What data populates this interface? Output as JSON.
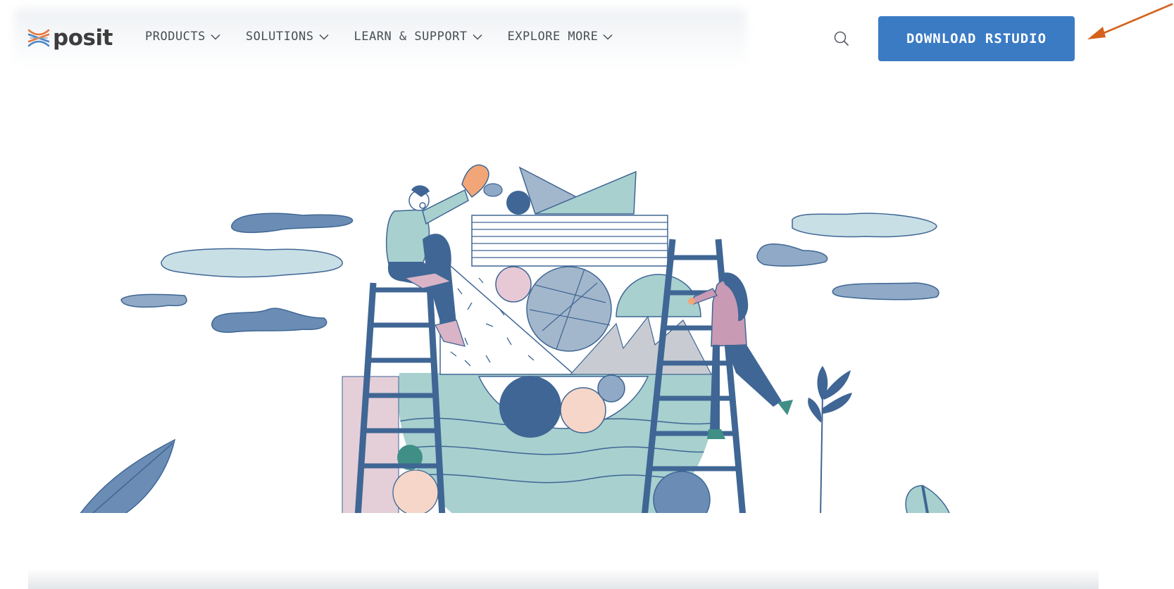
{
  "brand": {
    "name": "posit",
    "logo_icon": "posit-logo-icon"
  },
  "nav": {
    "items": [
      {
        "label": "PRODUCTS",
        "icon": "chevron-down-icon"
      },
      {
        "label": "SOLUTIONS",
        "icon": "chevron-down-icon"
      },
      {
        "label": "LEARN & SUPPORT",
        "icon": "chevron-down-icon"
      },
      {
        "label": "EXPLORE MORE",
        "icon": "chevron-down-icon"
      }
    ],
    "search_icon": "search-icon"
  },
  "cta": {
    "download_label": "DOWNLOAD RSTUDIO"
  },
  "hero": {
    "illustration": "people-building-shapes-illustration"
  },
  "colors": {
    "button": "#3b7bc4",
    "nav_text": "#4a4f55",
    "logo_orange": "#e8773b",
    "logo_blue": "#4a86c7",
    "annotation_arrow": "#d4621b",
    "illus_navy": "#3f6694",
    "illus_teal": "#a7d0cf",
    "illus_light_blue": "#c9dfe6",
    "illus_pink": "#d9b4c6",
    "illus_peach": "#f6d6c8",
    "illus_grey": "#c8ccd2",
    "illus_slate": "#a3b7cc"
  }
}
